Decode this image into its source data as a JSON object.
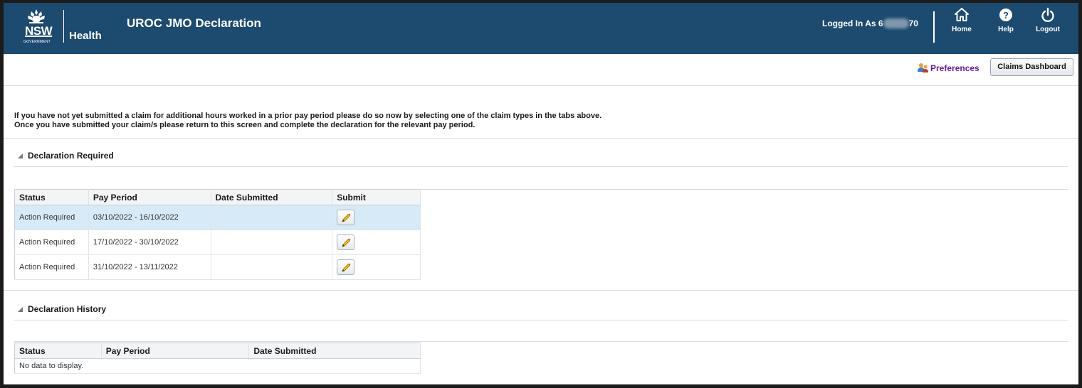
{
  "header": {
    "logo_nsw": "NSW",
    "logo_government": "GOVERNMENT",
    "logo_health": "Health",
    "app_title": "UROC JMO Declaration",
    "logged_in_prefix": "Logged In As 6",
    "logged_in_suffix": "70",
    "nav": [
      {
        "label": "Home",
        "icon": "home-icon"
      },
      {
        "label": "Help",
        "icon": "help-icon"
      },
      {
        "label": "Logout",
        "icon": "power-icon"
      }
    ]
  },
  "toolbar": {
    "preferences_label": "Preferences",
    "claims_dashboard_label": "Claims Dashboard"
  },
  "intro": {
    "line1": "If you have not yet submitted a claim for additional hours worked in a prior pay period please do so now by selecting one of the claim types in the tabs above.",
    "line2": "Once you have submitted your claim/s please return to this screen and complete the declaration for the relevant pay period."
  },
  "declaration_required": {
    "title": "Declaration Required",
    "columns": [
      "Status",
      "Pay Period",
      "Date Submitted",
      "Submit"
    ],
    "rows": [
      {
        "status": "Action Required",
        "pay_period": "03/10/2022 - 16/10/2022",
        "date_submitted": "",
        "selected": true
      },
      {
        "status": "Action Required",
        "pay_period": "17/10/2022 - 30/10/2022",
        "date_submitted": "",
        "selected": false
      },
      {
        "status": "Action Required",
        "pay_period": "31/10/2022 - 13/11/2022",
        "date_submitted": "",
        "selected": false
      }
    ]
  },
  "declaration_history": {
    "title": "Declaration History",
    "columns": [
      "Status",
      "Pay Period",
      "Date Submitted"
    ],
    "empty_text": "No data to display."
  },
  "colors": {
    "header_bg": "#1d4a6f",
    "selected_row": "#d6eaf8",
    "preferences_link": "#6a1b9a"
  }
}
